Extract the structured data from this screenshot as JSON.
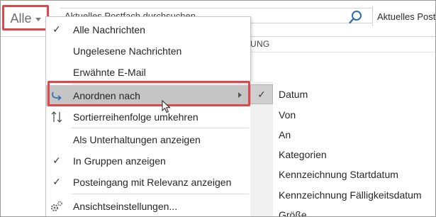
{
  "toolbar": {
    "filter_label": "Alle",
    "search_value": "Aktuelles Postfach durchsuchen",
    "scope_label": "Aktuelles Postfach",
    "column_header": "UNG"
  },
  "menu": {
    "items": [
      {
        "label": "Alle Nachrichten",
        "checked": true,
        "icon": "check-icon"
      },
      {
        "label": "Ungelesene Nachrichten",
        "checked": false
      },
      {
        "label": "Erwähnte E-Mail",
        "checked": false
      },
      {
        "label": "Anordnen nach",
        "icon": "arrange-icon",
        "submenu": true,
        "active": true
      },
      {
        "label": "Sortierreihenfolge umkehren",
        "icon": "reverse-sort-icon"
      },
      {
        "label": "Als Unterhaltungen anzeigen",
        "checked": false
      },
      {
        "label": "In Gruppen anzeigen",
        "checked": true,
        "icon": "check-icon"
      },
      {
        "label": "Posteingang mit Relevanz anzeigen",
        "checked": true,
        "icon": "check-icon"
      },
      {
        "label": "Ansichtseinstellungen...",
        "icon": "gear-icon"
      }
    ]
  },
  "submenu": {
    "items": [
      {
        "label": "Datum",
        "checked": true
      },
      {
        "label": "Von",
        "checked": false
      },
      {
        "label": "An",
        "checked": false
      },
      {
        "label": "Kategorien",
        "checked": false
      },
      {
        "label": "Kennzeichnung Startdatum",
        "checked": false
      },
      {
        "label": "Kennzeichnung Fälligkeitsdatum",
        "checked": false
      },
      {
        "label": "Größe",
        "checked": false
      }
    ]
  },
  "colors": {
    "highlight_box": "#e0474c",
    "search_icon": "#2b6cb0",
    "active_item_bg": "#c5c5c5"
  }
}
